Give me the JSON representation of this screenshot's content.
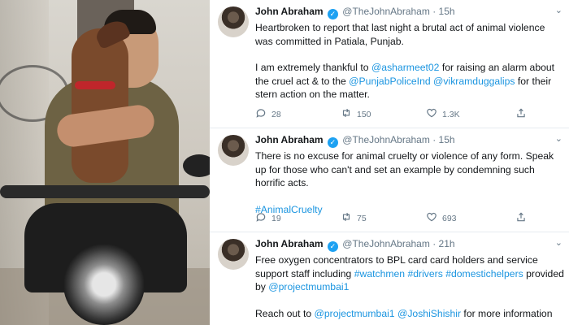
{
  "tweets": [
    {
      "name": "John Abraham",
      "handle": "@TheJohnAbraham",
      "time": "15h",
      "paragraphs": [
        [
          {
            "t": "Heartbroken to report that last night a brutal act of animal violence was committed in Patiala, Punjab."
          }
        ],
        [
          {
            "t": "I am extremely thankful to "
          },
          {
            "t": "@asharmeet02",
            "link": true
          },
          {
            "t": " for raising an alarm about the cruel act & to the "
          },
          {
            "t": "@PunjabPoliceInd",
            "link": true
          },
          {
            "t": " "
          },
          {
            "t": "@vikramduggalips",
            "link": true
          },
          {
            "t": " for their stern action on the matter."
          }
        ]
      ],
      "actions": {
        "replies": "28",
        "retweets": "150",
        "likes": "1.3K"
      }
    },
    {
      "name": "John Abraham",
      "handle": "@TheJohnAbraham",
      "time": "15h",
      "paragraphs": [
        [
          {
            "t": "There is no excuse for animal cruelty or violence of any form. Speak up for those who can't and set an example by condemning such horrific acts."
          }
        ],
        [
          {
            "t": "#AnimalCruelty",
            "link": true
          }
        ]
      ],
      "actions": {
        "replies": "19",
        "retweets": "75",
        "likes": "693"
      }
    },
    {
      "name": "John Abraham",
      "handle": "@TheJohnAbraham",
      "time": "21h",
      "paragraphs": [
        [
          {
            "t": "Free oxygen concentrators to BPL card card holders and service support staff including "
          },
          {
            "t": "#watchmen",
            "link": true
          },
          {
            "t": " "
          },
          {
            "t": "#drivers",
            "link": true
          },
          {
            "t": " "
          },
          {
            "t": "#domestichelpers",
            "link": true
          },
          {
            "t": " provided by "
          },
          {
            "t": "@projectmumbai1",
            "link": true
          }
        ],
        [
          {
            "t": "Reach out to "
          },
          {
            "t": "@projectmumbai1",
            "link": true
          },
          {
            "t": " "
          },
          {
            "t": "@JoshiShishir",
            "link": true
          },
          {
            "t": " for more information"
          }
        ]
      ],
      "actions": null
    }
  ],
  "icons": {
    "verified": "verified-badge-icon",
    "reply": "reply-icon",
    "retweet": "retweet-icon",
    "like": "heart-icon",
    "share": "share-icon",
    "more": "chevron-down-icon"
  },
  "colors": {
    "link": "#1b95e0",
    "verified": "#1da1f2",
    "muted": "#657786",
    "text": "#14171a",
    "divider": "#e6ecf0"
  }
}
